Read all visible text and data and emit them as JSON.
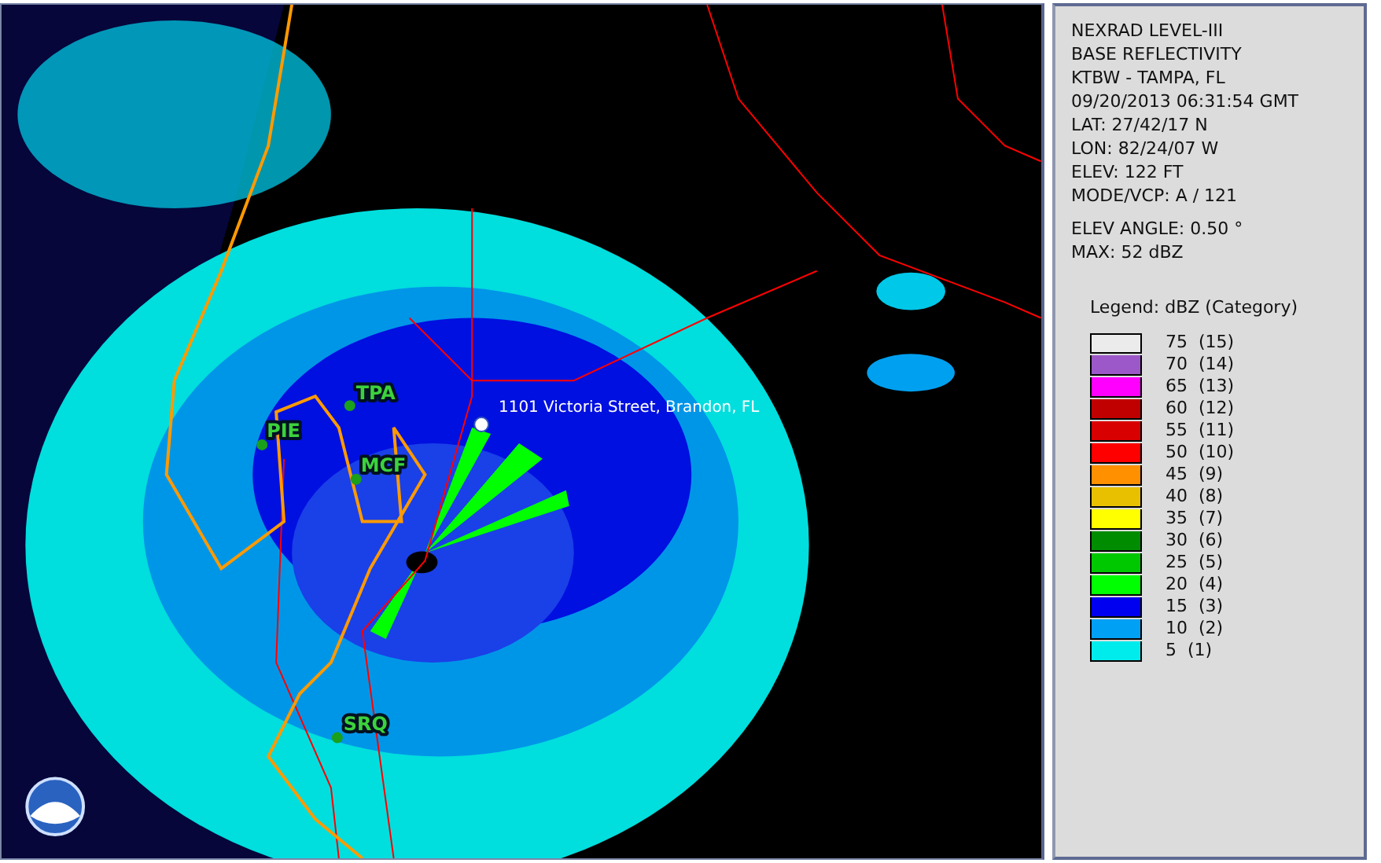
{
  "map": {
    "address": "1101 Victoria Street, Brandon, FL",
    "stations": [
      {
        "label": "TPA"
      },
      {
        "label": "PIE"
      },
      {
        "label": "MCF"
      },
      {
        "label": "SRQ"
      }
    ]
  },
  "info": {
    "lines": [
      "NEXRAD LEVEL-III",
      "BASE REFLECTIVITY",
      "KTBW - TAMPA, FL",
      "09/20/2013 06:31:54 GMT",
      "LAT: 27/42/17 N",
      "LON: 82/24/07 W",
      "ELEV: 122 FT",
      "MODE/VCP: A / 121"
    ],
    "extra_lines": [
      "ELEV ANGLE: 0.50 °",
      "MAX: 52 dBZ"
    ]
  },
  "legend": {
    "title": "Legend: dBZ (Category)",
    "items": [
      {
        "label": "75  (15)",
        "color": "#ebebeb"
      },
      {
        "label": "70  (14)",
        "color": "#9c58c8"
      },
      {
        "label": "65  (13)",
        "color": "#ff00ff"
      },
      {
        "label": "60  (12)",
        "color": "#c00000"
      },
      {
        "label": "55  (11)",
        "color": "#d80000"
      },
      {
        "label": "50  (10)",
        "color": "#ff0000"
      },
      {
        "label": "45  (9)",
        "color": "#ff9000"
      },
      {
        "label": "40  (8)",
        "color": "#e8c000"
      },
      {
        "label": "35  (7)",
        "color": "#ffff00"
      },
      {
        "label": "30  (6)",
        "color": "#008c00"
      },
      {
        "label": "25  (5)",
        "color": "#00c800"
      },
      {
        "label": "20  (4)",
        "color": "#00ff00"
      },
      {
        "label": "15  (3)",
        "color": "#0000f0"
      },
      {
        "label": "10  (2)",
        "color": "#00a0f5"
      },
      {
        "label": "5  (1)",
        "color": "#00ecec"
      }
    ]
  }
}
